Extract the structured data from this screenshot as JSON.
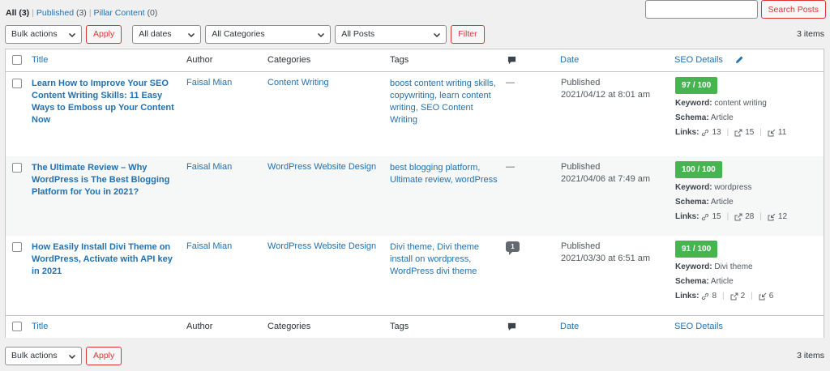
{
  "views": [
    {
      "label": "All",
      "count": "(3)",
      "current": true
    },
    {
      "label": "Published",
      "count": "(3)",
      "current": false
    },
    {
      "label": "Pillar Content",
      "count": "(0)",
      "current": false
    }
  ],
  "views_sep": "|",
  "search": {
    "placeholder": "",
    "button": "Search Posts"
  },
  "filters": {
    "bulk_actions": "Bulk actions",
    "apply": "Apply",
    "dates": "All dates",
    "categories": "All Categories",
    "posts": "All Posts",
    "filter": "Filter"
  },
  "items_count": "3 items",
  "columns": {
    "title": "Title",
    "author": "Author",
    "categories": "Categories",
    "tags": "Tags",
    "date": "Date",
    "seo": "SEO Details"
  },
  "rows": [
    {
      "title": "Learn How to Improve Your SEO Content Writing Skills: 11 Easy Ways to Emboss up Your Content Now",
      "author": "Faisal Mian",
      "categories": "Content Writing",
      "tags": "boost content writing skills, copywriting, learn content writing, SEO Content Writing",
      "comments": "—",
      "status": "Published",
      "date": "2021/04/12 at 8:01 am",
      "score": "97 / 100",
      "keyword_label": "Keyword:",
      "keyword": "content writing",
      "schema_label": "Schema:",
      "schema": "Article",
      "links_label": "Links:",
      "links_internal": "13",
      "links_external": "15",
      "links_incoming": "11"
    },
    {
      "title": "The Ultimate Review – Why WordPress is The Best Blogging Platform for You in 2021?",
      "author": "Faisal Mian",
      "categories": "WordPress Website Design",
      "tags": "best blogging platform, Ultimate review, wordPress",
      "comments": "—",
      "status": "Published",
      "date": "2021/04/06 at 7:49 am",
      "score": "100 / 100",
      "keyword_label": "Keyword:",
      "keyword": "wordpress",
      "schema_label": "Schema:",
      "schema": "Article",
      "links_label": "Links:",
      "links_internal": "15",
      "links_external": "28",
      "links_incoming": "12"
    },
    {
      "title": "How Easily Install Divi Theme on WordPress, Activate with API key in 2021",
      "author": "Faisal Mian",
      "categories": "WordPress Website Design",
      "tags": "Divi theme, Divi theme install on wordpress, WordPress divi theme",
      "comments": "1",
      "status": "Published",
      "date": "2021/03/30 at 6:51 am",
      "score": "91 / 100",
      "keyword_label": "Keyword:",
      "keyword": "Divi theme",
      "schema_label": "Schema:",
      "schema": "Article",
      "links_label": "Links:",
      "links_internal": "8",
      "links_external": "2",
      "links_incoming": "6"
    }
  ],
  "colors": {
    "accent": "#2271b1",
    "danger": "#d63638",
    "score_good": "#46b450"
  }
}
